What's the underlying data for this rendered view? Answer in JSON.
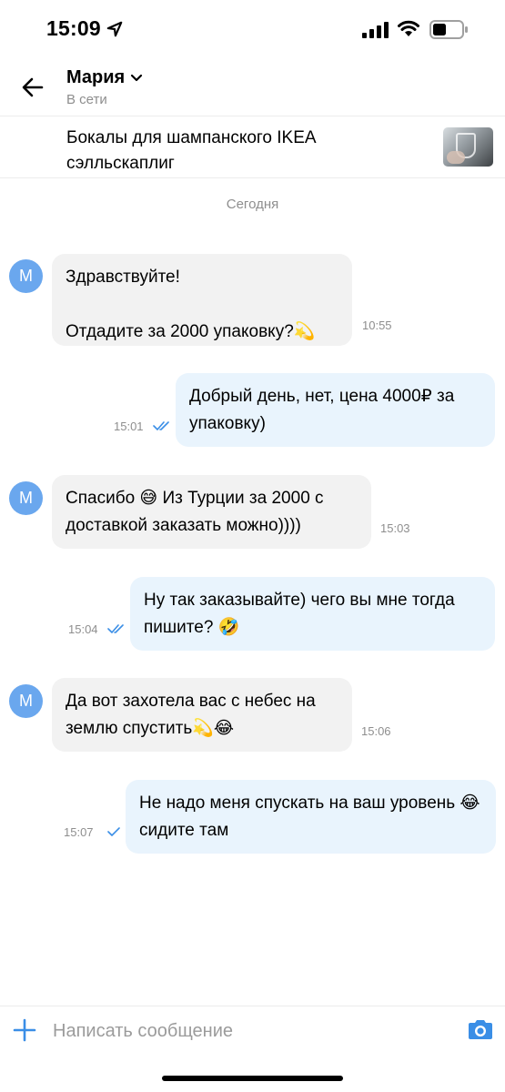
{
  "status_bar": {
    "time": "15:09",
    "location_icon": "location-arrow-icon",
    "signal_icon": "cellular-signal-icon",
    "wifi_icon": "wifi-icon",
    "battery_icon": "battery-icon"
  },
  "header": {
    "back_icon": "arrow-left-icon",
    "contact_name": "Мария",
    "chevron_icon": "chevron-down-icon",
    "contact_status": "В сети"
  },
  "item": {
    "title": "Бокалы для шампанского IKEA сэлльскаплиг"
  },
  "chat": {
    "date_separator": "Сегодня",
    "messages": [
      {
        "direction": "in",
        "avatar_letter": "М",
        "text": "Здравствуйте!\n\nОтдадите за 2000 упаковку?💫",
        "time": "10:55"
      },
      {
        "direction": "out",
        "text": "Добрый день, нет, цена 4000₽ за упаковку)",
        "time": "15:01",
        "status": "read"
      },
      {
        "direction": "in",
        "avatar_letter": "М",
        "text": "Спасибо 😅 Из Турции за 2000 с доставкой заказать можно))))",
        "time": "15:03"
      },
      {
        "direction": "out",
        "text": "Ну так заказывайте) чего вы мне тогда пишите? 🤣",
        "time": "15:04",
        "status": "read"
      },
      {
        "direction": "in",
        "avatar_letter": "М",
        "text": "Да вот захотела вас с небес на землю спустить💫😂",
        "time": "15:06"
      },
      {
        "direction": "out",
        "text": "Не надо меня спускать на ваш уровень 😂 сидите там",
        "time": "15:07",
        "status": "sent"
      }
    ]
  },
  "composer": {
    "plus_icon": "plus-icon",
    "placeholder": "Написать сообщение",
    "value": "",
    "camera_icon": "camera-icon"
  },
  "colors": {
    "accent": "#3a8ee6",
    "avatar_bg": "#6aa7ee",
    "incoming_bubble": "#f2f2f2",
    "outgoing_bubble": "#e9f4fd",
    "secondary_text": "#8e8e8e"
  }
}
